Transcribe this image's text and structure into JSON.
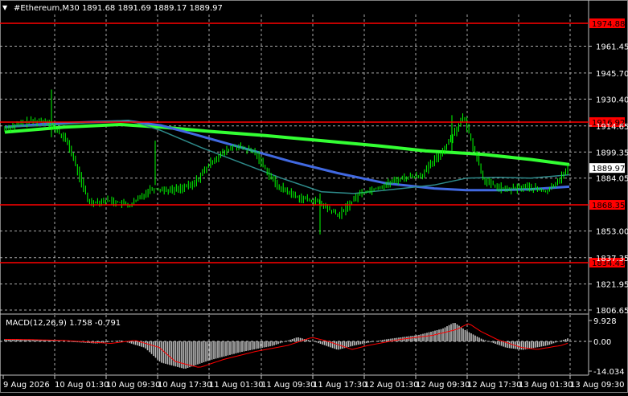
{
  "window": {
    "symbol_line": "#Ethereum,M30  1891.68 1891.69 1889.17 1889.97",
    "collapse_arrow": "▼"
  },
  "main_chart": {
    "y_axis_labels": [
      "1961.45",
      "1945.70",
      "1930.40",
      "1914.65",
      "1899.35",
      "1884.05",
      "1853.00",
      "1837.35",
      "1821.95",
      "1806.65"
    ],
    "price_levels": [
      {
        "label": "1974.88",
        "value": 1974.88
      },
      {
        "label": "1916.92",
        "value": 1916.92
      },
      {
        "label": "1868.35",
        "value": 1868.35
      },
      {
        "label": "1834.43",
        "value": 1834.43
      }
    ],
    "current_price_label": "1889.97",
    "current_price": 1889.97,
    "ylim": [
      1800.5,
      1984.5
    ],
    "colors": {
      "level_line": "#ff0000",
      "level_box": "#ff0000",
      "candles": "#00ff00",
      "ma_slow": "#33ff33",
      "ma_mid": "#4169e1",
      "ma_fast": "#2e8b8b"
    }
  },
  "macd": {
    "label": "MACD(12,26,9) 1.758 -0.791",
    "y_axis_labels": [
      "9.928",
      "0.00",
      "-14.034"
    ],
    "ylim": [
      -14.034,
      9.928
    ],
    "colors": {
      "histogram": "#c0c0c0",
      "signal": "#ff0000"
    }
  },
  "time_axis": {
    "labels": [
      "9 Aug 2026",
      "10 Aug 01:30",
      "10 Aug 09:30",
      "10 Aug 17:30",
      "11 Aug 01:30",
      "11 Aug 09:30",
      "11 Aug 17:30",
      "12 Aug 01:30",
      "12 Aug 09:30",
      "12 Aug 17:30",
      "13 Aug 01:30",
      "13 Aug 09:30"
    ]
  },
  "chart_data": {
    "type": "line",
    "title": "#Ethereum,M30",
    "x": [
      "9 Aug 2026",
      "10 Aug 01:30",
      "10 Aug 09:30",
      "10 Aug 17:30",
      "11 Aug 01:30",
      "11 Aug 09:30",
      "11 Aug 17:30",
      "12 Aug 01:30",
      "12 Aug 09:30",
      "12 Aug 17:30",
      "13 Aug 01:30",
      "13 Aug 09:30"
    ],
    "ylim": [
      1806.65,
      1974.88
    ],
    "series": [
      {
        "name": "",
        "values": [
          1913,
          1917,
          1918,
          1905,
          1870,
          1871,
          1868,
          1878,
          1877,
          1880,
          1895,
          1903,
          1899,
          1880,
          1873,
          1870,
          1862,
          1875,
          1879,
          1884,
          1886,
          1900,
          1920,
          1882,
          1877,
          1879,
          1876,
          1889
        ]
      }
    ]
  }
}
